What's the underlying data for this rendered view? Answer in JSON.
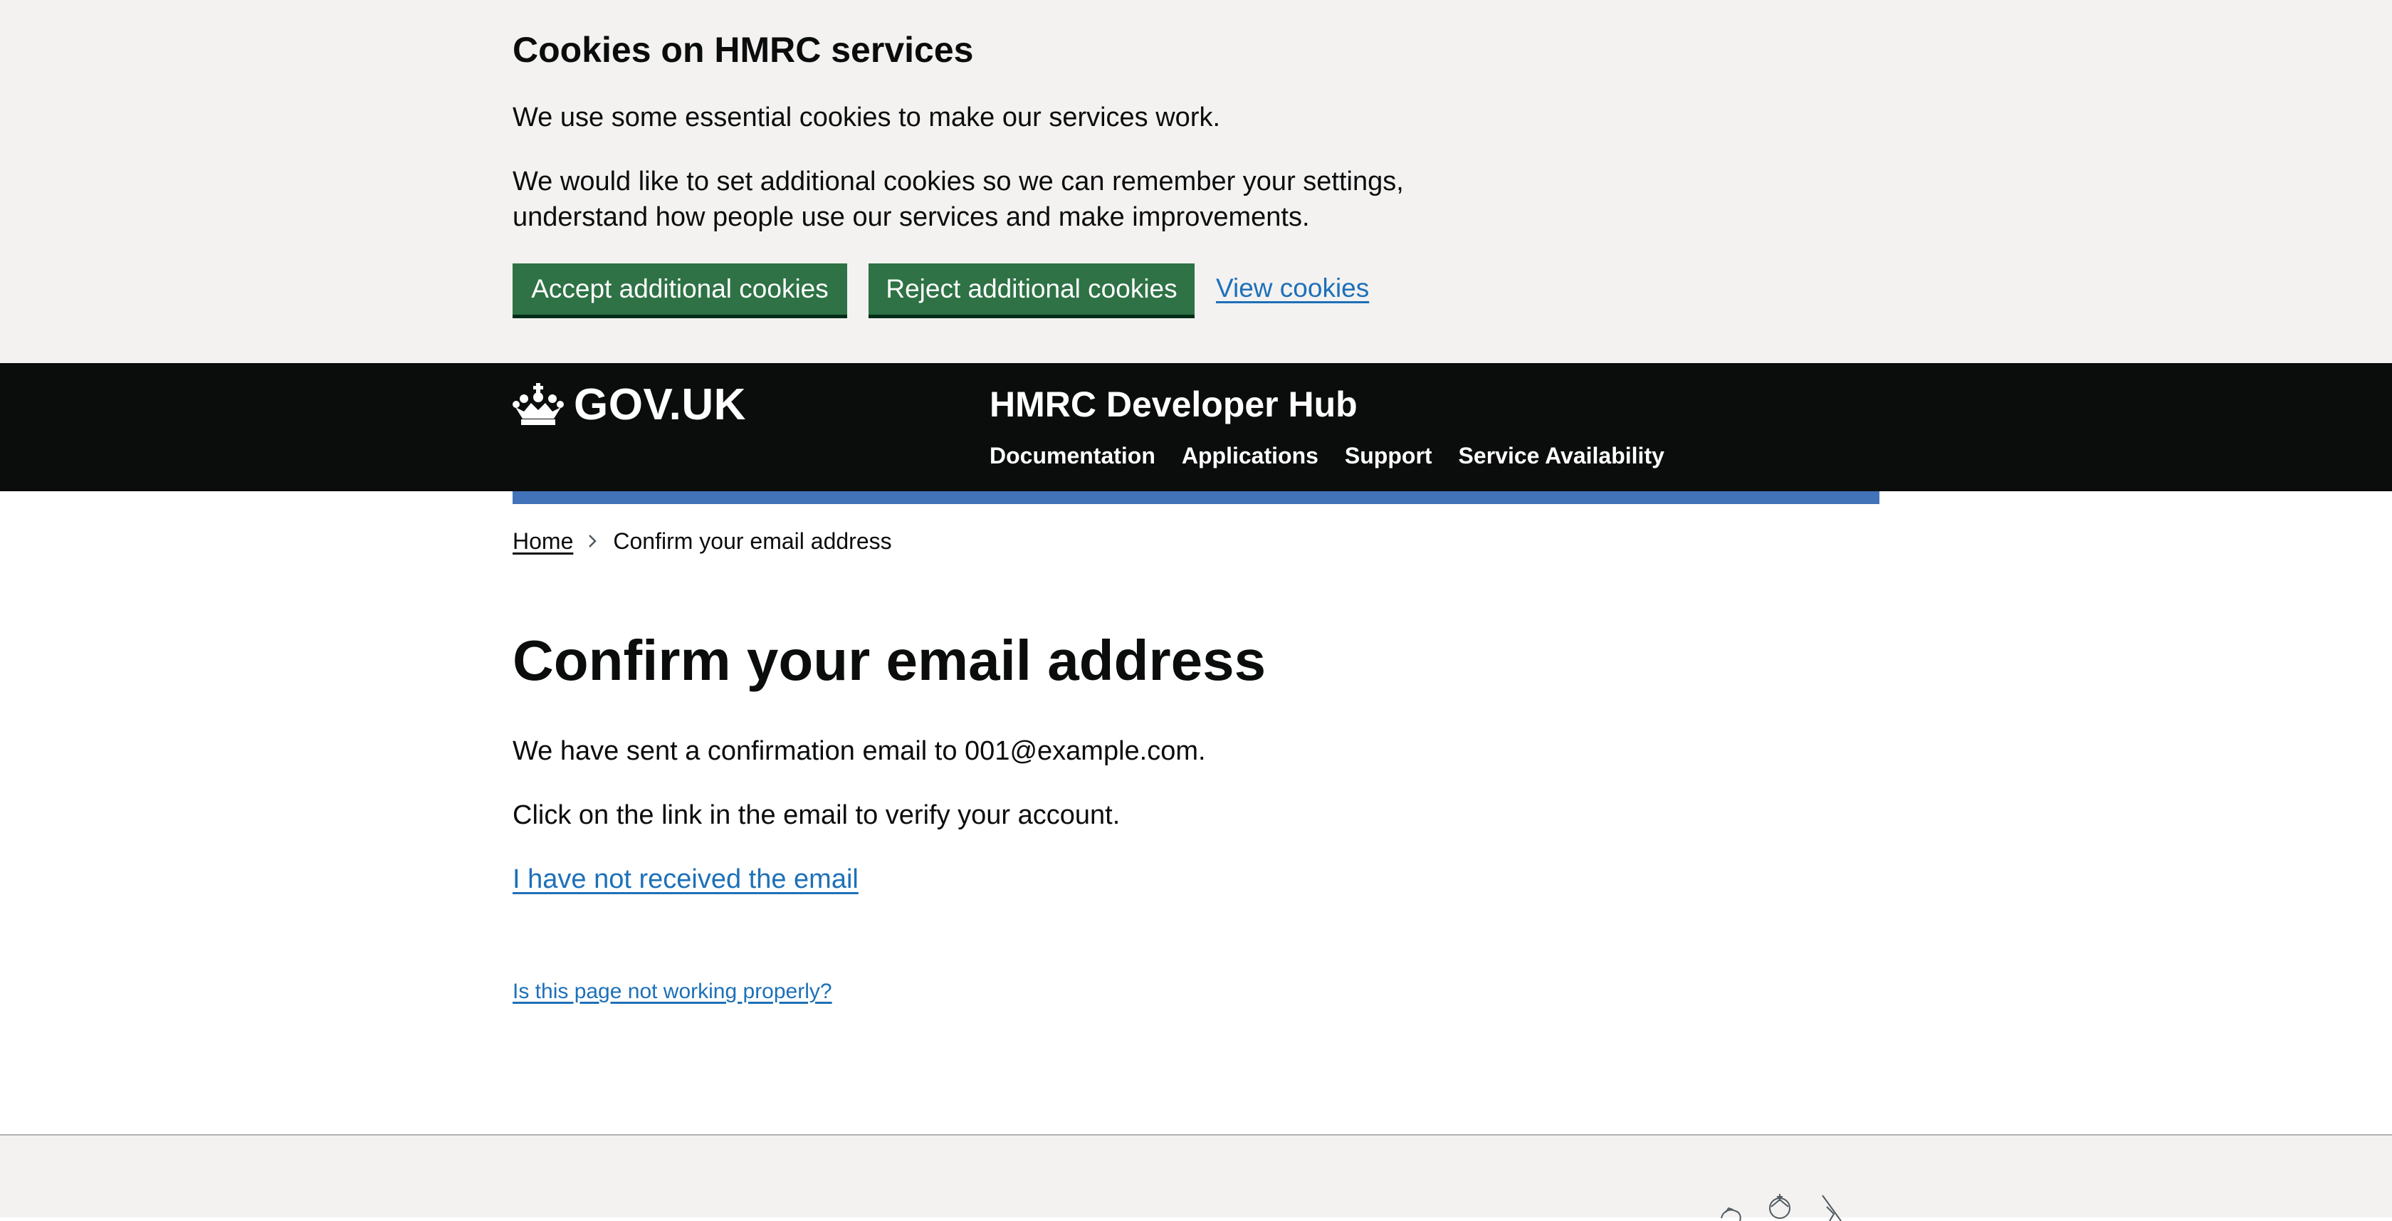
{
  "cookie_banner": {
    "title": "Cookies on HMRC services",
    "para1": "We use some essential cookies to make our services work.",
    "para2": "We would like to set additional cookies so we can remember your settings, understand how people use our services and make improvements.",
    "accept_label": "Accept additional cookies",
    "reject_label": "Reject additional cookies",
    "view_label": "View cookies"
  },
  "header": {
    "logo_text": "GOV.UK",
    "service_name": "HMRC Developer Hub",
    "nav": [
      {
        "label": "Documentation"
      },
      {
        "label": "Applications"
      },
      {
        "label": "Support"
      },
      {
        "label": "Service Availability"
      }
    ]
  },
  "breadcrumb": {
    "home": "Home",
    "current": "Confirm your email address"
  },
  "main": {
    "title": "Confirm your email address",
    "sent_text": "We have sent a confirmation email to 001@example.com.",
    "instruction_text": "Click on the link in the email to verify your account.",
    "resend_link": "I have not received the email",
    "report_link": "Is this page not working properly?"
  },
  "colors": {
    "link": "#1d70b8",
    "button": "#2e7245",
    "header_bg": "#0b0c0c",
    "banner_bg": "#f3f2f1",
    "accent_bar": "#4273b8"
  },
  "icons": [
    "crown-icon",
    "chevron-right-icon",
    "royal-crest-icon"
  ]
}
